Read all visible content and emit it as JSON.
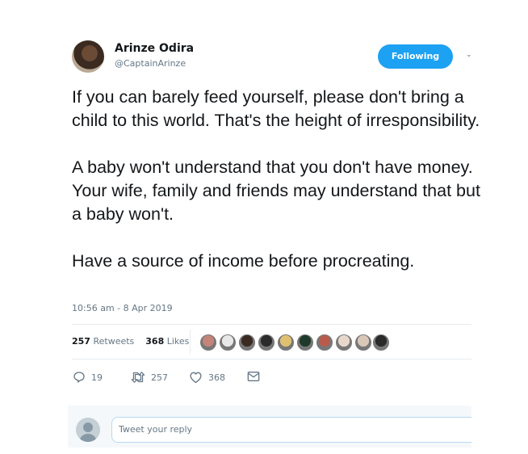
{
  "user": {
    "name": "Arinze Odira",
    "handle": "@CaptainArinze",
    "follow_label": "Following"
  },
  "tweet": {
    "paragraphs": [
      "If you can barely feed yourself, please don't bring a child to this world. That's the height of irresponsibility.",
      "A baby won't understand that you don't have money. Your wife, family and friends may understand that but a baby won't.",
      "Have a source of income before procreating."
    ],
    "timestamp": "10:56 am - 8 Apr 2019"
  },
  "stats": {
    "retweets_count": "257",
    "retweets_label": "Retweets",
    "likes_count": "368",
    "likes_label": "Likes"
  },
  "actions": {
    "reply_count": "19",
    "retweet_count": "257",
    "like_count": "368"
  },
  "likers_colors": [
    "#c4847a",
    "#e8e8e8",
    "#3a2a22",
    "#2b2b2b",
    "#e0c070",
    "#1f3a2a",
    "#b95b4c",
    "#e8d8cc",
    "#d9c7b8",
    "#2a2a2a"
  ],
  "reply": {
    "placeholder": "Tweet your reply"
  },
  "colors": {
    "accent": "#1da1f2",
    "text": "#14171a",
    "secondary": "#657786"
  }
}
